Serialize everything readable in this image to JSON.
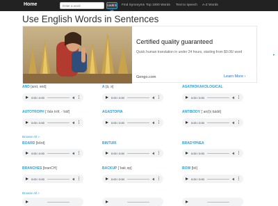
{
  "navbar": {
    "brand": "Home",
    "search_placeholder": "Enter a word",
    "go_label": "Look it up",
    "links": [
      "Find Synonyms",
      "Top 1000 Words",
      "Text to speech",
      "A-Z Words"
    ]
  },
  "page": {
    "title": "Use English Words in Sentences"
  },
  "ad": {
    "title": "Certified quality guaranteed",
    "text": "Quick human translation in under 24 hours, starting from $0.06/ word",
    "brand": "Gengo.com",
    "cta": "Learn More",
    "cta_arrow": "›",
    "choices_icon": "adchoices-icon"
  },
  "sections": [
    {
      "entries": [
        {
          "word": "AND",
          "pron": "[and, ənd]",
          "time": "0:00 / 0:00"
        },
        {
          "word": "A",
          "pron": "[ā, ə]",
          "time": "0:00 / 0:00"
        },
        {
          "word": "AGATHOKAKOLOGICAL",
          "pron": "",
          "time": "0:00 / 0:00"
        },
        {
          "word": "AUTOTROPH",
          "pron": "[ˈôdəˌtrōf, -ˈträf]",
          "time": "0:00 / 0:00"
        },
        {
          "word": "AGASTOPIA",
          "pron": "",
          "time": "0:00 / 0:00"
        },
        {
          "word": "ANTIBODY",
          "pron": "[ˈan(t)iˌbädē]",
          "time": "0:00 / 0:00"
        }
      ],
      "browse": "Browse All »"
    },
    {
      "entries": [
        {
          "word": "BOARD",
          "pron": "[bôrd]",
          "time": "0:00 / 0:00"
        },
        {
          "word": "BINTURI",
          "pron": "",
          "time": "0:00 / 0:00"
        },
        {
          "word": "BRADYPNEA",
          "pron": "",
          "time": "0:00 / 0:00"
        },
        {
          "word": "BRANCHES",
          "pron": "[branCH]",
          "time": "0:00 / 0:00"
        },
        {
          "word": "BACKUP",
          "pron": "[ˈbakˌəp]",
          "time": "0:00 / 0:00"
        },
        {
          "word": "BOW",
          "pron": "[bō]",
          "time": "0:00 / 0:00"
        }
      ],
      "browse": "Browse All »"
    }
  ],
  "colors": {
    "accent": "#2a9fd6",
    "navbar": "#222222"
  }
}
